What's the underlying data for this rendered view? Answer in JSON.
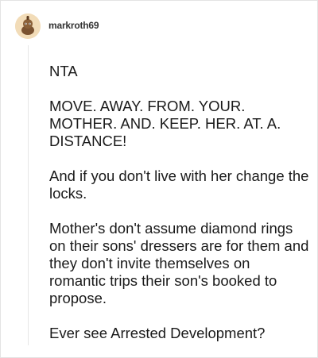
{
  "comment": {
    "username": "markroth69",
    "avatar_icon": "snoo-avatar-icon",
    "paragraphs": [
      "NTA",
      "MOVE. AWAY. FROM. YOUR. MOTHER. AND. KEEP. HER. AT. A. DISTANCE!",
      "And if you don't live with her change the locks.",
      "Mother's don't assume diamond rings on their sons' dressers are for them and they don't invite themselves on romantic trips their son's booked to propose.",
      "Ever see Arrested Development?"
    ]
  },
  "colors": {
    "avatar_bg": "#f2dcb8",
    "avatar_figure": "#7a5230",
    "text": "#1a1a1a",
    "thread_line": "#e6e6e6"
  }
}
